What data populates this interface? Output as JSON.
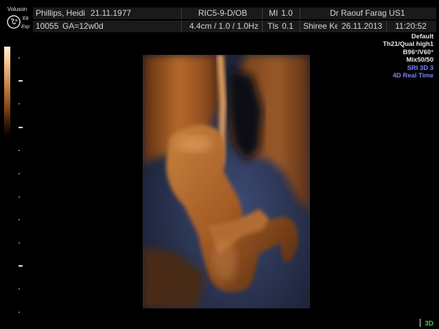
{
  "logo": {
    "brand": "Voluson",
    "model": "E8",
    "sub": "Exp",
    "icon": "ge-logo-icon"
  },
  "header": {
    "patient_name": "Phillips, Heidi",
    "patient_dob": "21.11.1977",
    "probe_preset": "RIC5-9-D/OB",
    "mi_label": "MI",
    "mi_value": "1.0",
    "operator": "Dr Raouf Farag US1",
    "patient_id": "10055",
    "gestational_age": "GA=12w0d",
    "depth_settings": "4.4cm / 1.0 / 1.0Hz",
    "tis_label": "Tls",
    "tis_value": "0.1",
    "site": "Shiree Ke",
    "date": "26.11.2013",
    "time": "11:20:52"
  },
  "info_panel": {
    "lines": [
      {
        "text": "Default",
        "color": "#e8e8e8"
      },
      {
        "text": "Th21/Qual high1",
        "color": "#e8e8e8"
      },
      {
        "text": "B96°/V60°",
        "color": "#e8e8e8"
      },
      {
        "text": "Mix50/50",
        "color": "#e8e8e8"
      },
      {
        "text": "SRI 3D 3",
        "color": "#7a83ff"
      },
      {
        "text": "4D Real Time",
        "color": "#7a83ff"
      }
    ]
  },
  "mode_indicator": "3D",
  "colors": {
    "background": "#000000",
    "header_bg": "#1a1a1a",
    "tissue_orange": "#b86a2c",
    "shadow_blue": "#4b5a85",
    "accent_blue": "#7a83ff",
    "indicator_green": "#3cc45a"
  }
}
